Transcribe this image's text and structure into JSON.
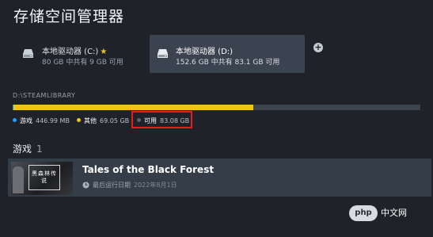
{
  "window": {
    "title": "存储空间管理器"
  },
  "drives": [
    {
      "name": "本地驱动器 (C:)",
      "info": "80 GB 中共有 9 GB 可用",
      "default": true,
      "star_icon": "star-icon"
    },
    {
      "name": "本地驱动器 (D:)",
      "info": "152.6 GB 中共有 83.1 GB 可用",
      "selected": true
    }
  ],
  "library": {
    "path": "D:\\STEAMLIBRARY",
    "usage": {
      "total_gb": 600,
      "segments": [
        {
          "label": "游戏",
          "value": "446.99 MB",
          "gb": 0.447,
          "color": "#1a9fff"
        },
        {
          "label": "其他",
          "value": "69.05 GB",
          "gb": 69.05,
          "color": "#f2c21a"
        },
        {
          "label": "可用",
          "value": "83.08 GB",
          "gb": 83.08,
          "color": "#3c434d"
        }
      ],
      "bar_fill_fraction": 0.59
    }
  },
  "games_section": {
    "label": "游戏",
    "count": "1"
  },
  "games": [
    {
      "title": "Tales of the Black Forest",
      "thumb_text": "黑森林传说",
      "last_played_label": "最后运行日期",
      "last_played_date": "2022年8月1日"
    }
  ],
  "watermark": {
    "logo_text": "php",
    "site": "中文网"
  },
  "colors": {
    "background": "#1f2329",
    "selected_drive": "#3b4350",
    "game_row": "#353d48",
    "highlight": "#e61d1d"
  }
}
